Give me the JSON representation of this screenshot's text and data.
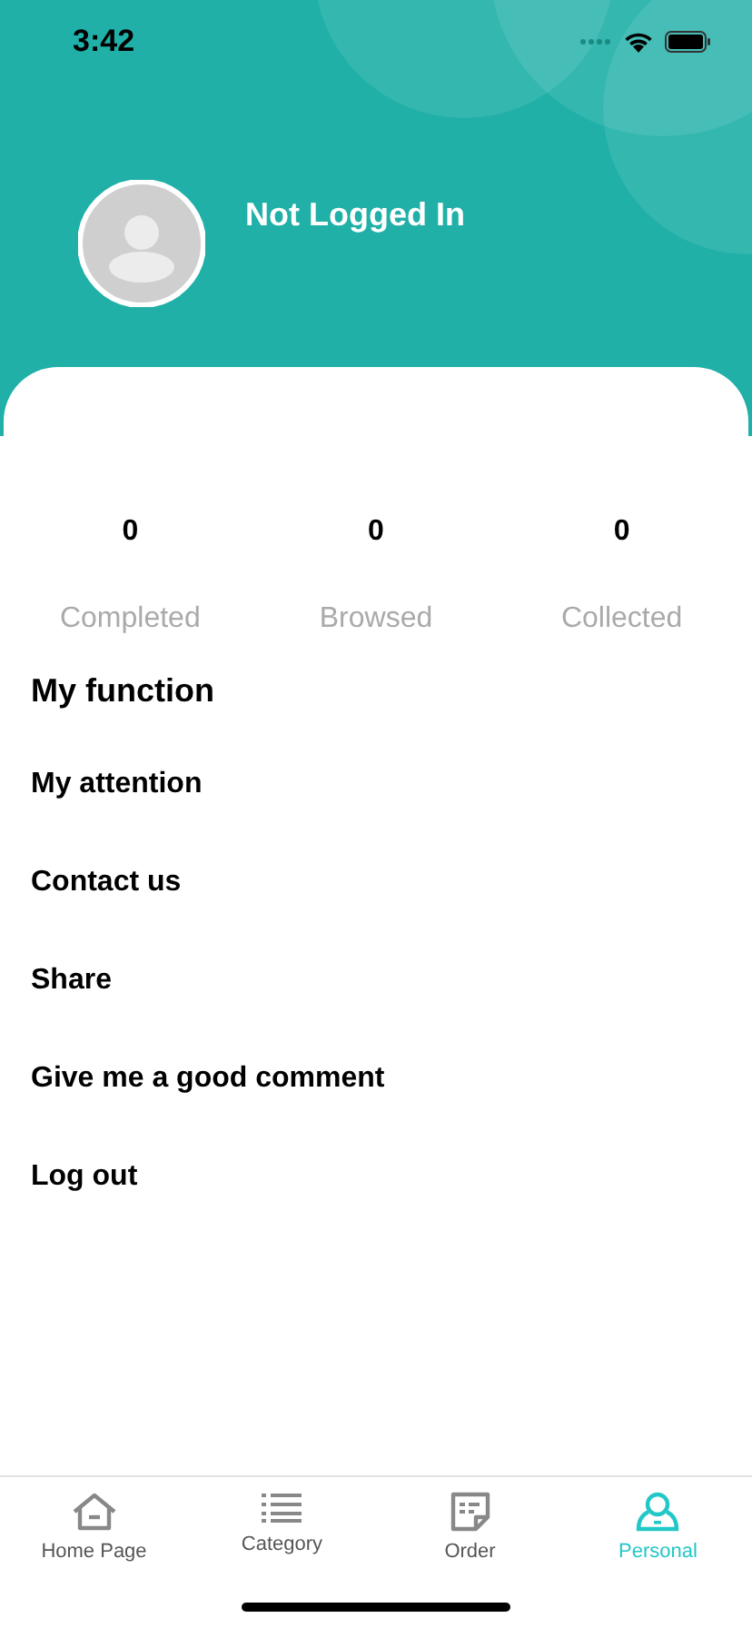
{
  "status_bar": {
    "time": "3:42"
  },
  "profile": {
    "name": "Not Logged In"
  },
  "stats": [
    {
      "value": "0",
      "label": "Completed"
    },
    {
      "value": "0",
      "label": "Browsed"
    },
    {
      "value": "0",
      "label": "Collected"
    }
  ],
  "section_title": "My function",
  "menu": [
    "My attention",
    "Contact us",
    "Share",
    "Give me a good comment",
    "Log out"
  ],
  "tabs": [
    {
      "label": "Home Page",
      "kind": "home",
      "selected": false
    },
    {
      "label": "Category",
      "kind": "list",
      "selected": false
    },
    {
      "label": "Order",
      "kind": "order",
      "selected": false
    },
    {
      "label": "Personal",
      "kind": "person",
      "selected": true
    }
  ]
}
